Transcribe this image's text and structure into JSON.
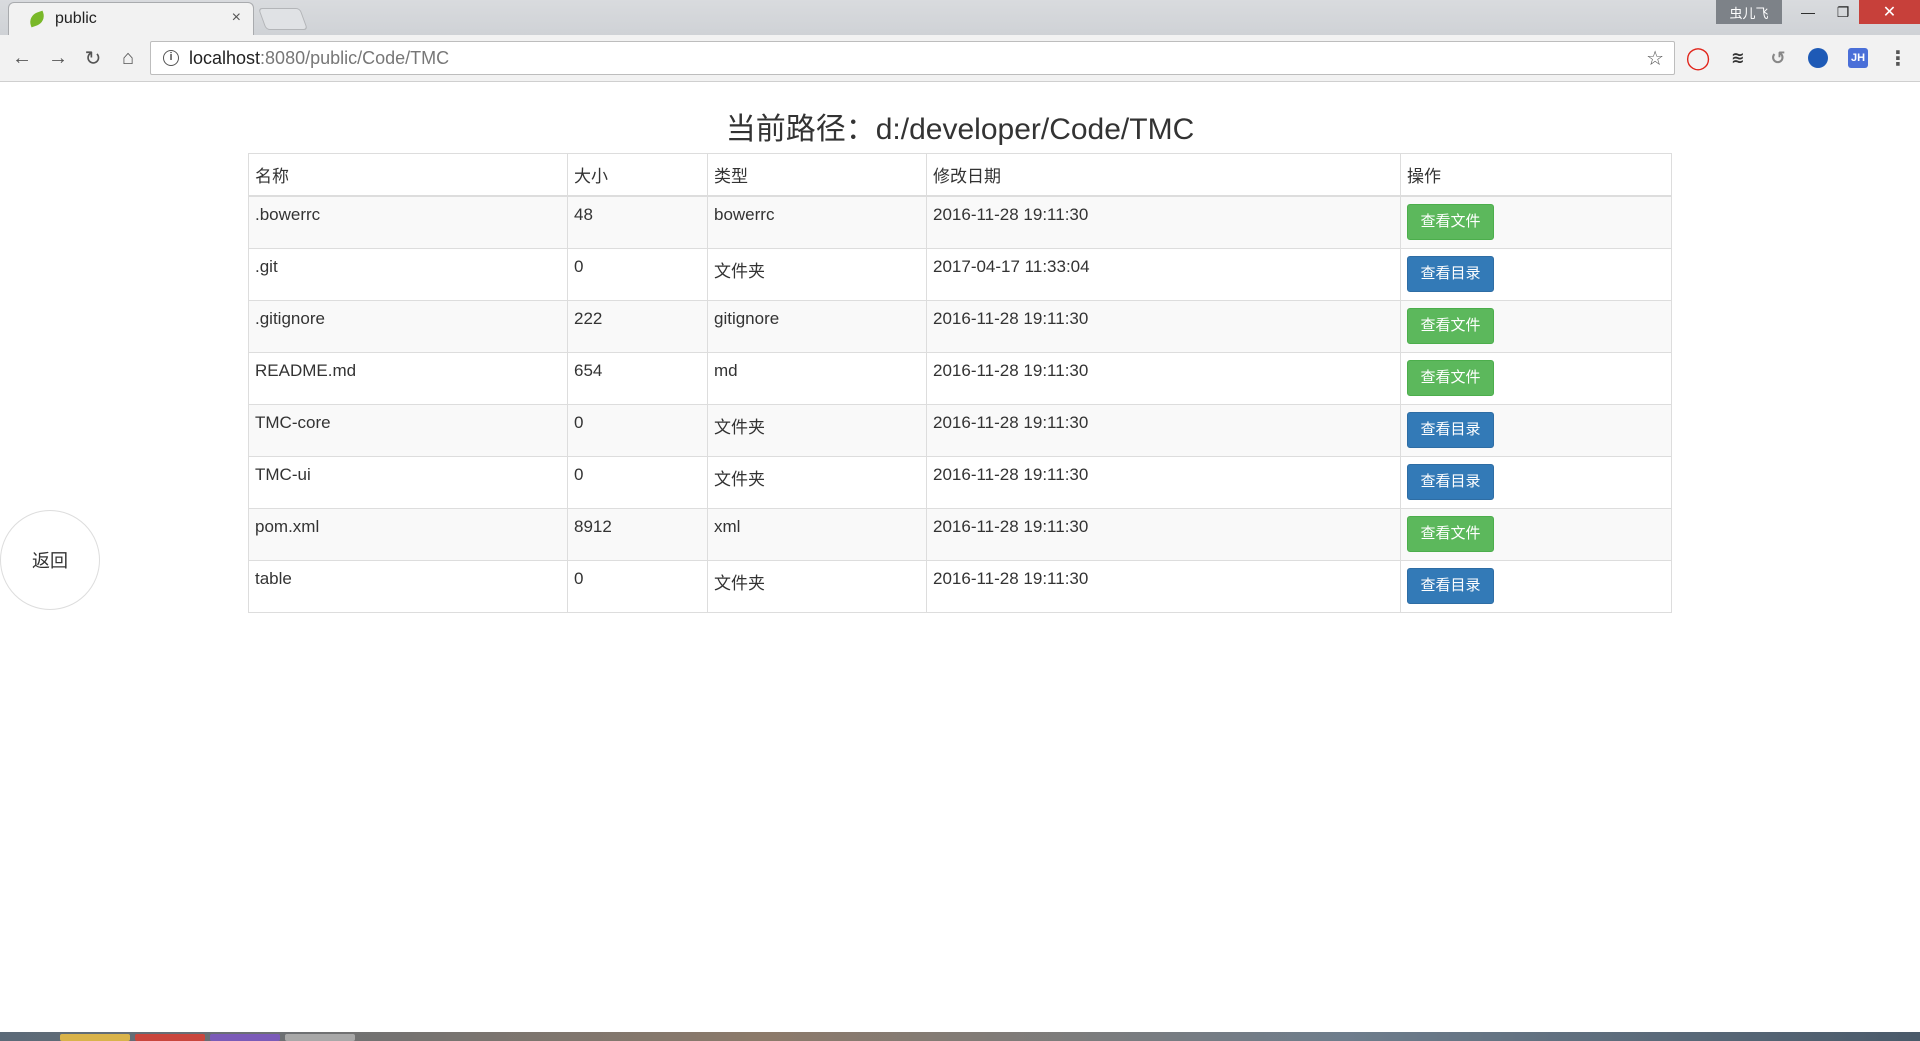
{
  "browser": {
    "tab_title": "public",
    "tab_close": "×",
    "user_badge": "虫儿飞",
    "win_min": "—",
    "win_max": "❐",
    "win_close": "✕",
    "url_host": "localhost",
    "url_path": ":8080/public/Code/TMC",
    "ext_jh": "JH"
  },
  "page": {
    "title": "当前路径：d:/developer/Code/TMC",
    "back_label": "返回"
  },
  "table": {
    "headers": [
      "名称",
      "大小",
      "类型",
      "修改日期",
      "操作"
    ],
    "rows": [
      {
        "name": ".bowerrc",
        "size": "48",
        "type": "bowerrc",
        "date": "2016-11-28 19:11:30",
        "action": "查看文件",
        "kind": "file"
      },
      {
        "name": ".git",
        "size": "0",
        "type": "文件夹",
        "date": "2017-04-17 11:33:04",
        "action": "查看目录",
        "kind": "dir"
      },
      {
        "name": ".gitignore",
        "size": "222",
        "type": "gitignore",
        "date": "2016-11-28 19:11:30",
        "action": "查看文件",
        "kind": "file"
      },
      {
        "name": "README.md",
        "size": "654",
        "type": "md",
        "date": "2016-11-28 19:11:30",
        "action": "查看文件",
        "kind": "file"
      },
      {
        "name": "TMC-core",
        "size": "0",
        "type": "文件夹",
        "date": "2016-11-28 19:11:30",
        "action": "查看目录",
        "kind": "dir"
      },
      {
        "name": "TMC-ui",
        "size": "0",
        "type": "文件夹",
        "date": "2016-11-28 19:11:30",
        "action": "查看目录",
        "kind": "dir"
      },
      {
        "name": "pom.xml",
        "size": "8912",
        "type": "xml",
        "date": "2016-11-28 19:11:30",
        "action": "查看文件",
        "kind": "file"
      },
      {
        "name": "table",
        "size": "0",
        "type": "文件夹",
        "date": "2016-11-28 19:11:30",
        "action": "查看目录",
        "kind": "dir"
      }
    ]
  },
  "colors": {
    "file_button": "#5cb85c",
    "dir_button": "#337ab7"
  }
}
